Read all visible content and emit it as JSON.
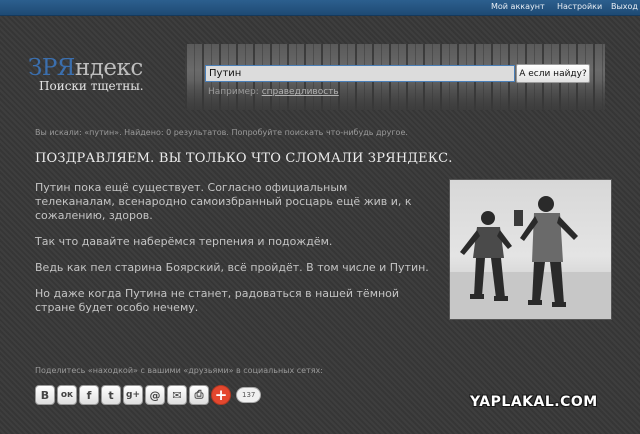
{
  "topnav": {
    "account": "Мой аккаунт",
    "settings": "Настройки",
    "exit": "Выход"
  },
  "logo": {
    "part_blue": "ЗРЯ",
    "part_gray": "ндекс",
    "tagline": "Поиски тщетны."
  },
  "search": {
    "value": "Путин",
    "button": "А если найду?",
    "example_prefix": "Например:",
    "example_link": "справедливость"
  },
  "results": {
    "summary": "Вы искали: «путин». Найдено: 0 результатов. Попробуйте поискать что-нибудь другое."
  },
  "article": {
    "headline": "ПОЗДРАВЛЯЕМ. ВЫ ТОЛЬКО ЧТО СЛОМАЛИ ЗРЯНДЕКС.",
    "paragraphs": [
      "Путин пока ещё существует. Согласно официальным телеканалам, всенародно самоизбранный росцарь ещё жив и, к сожалению, здоров.",
      "Так что давайте наберёмся терпения и подождём.",
      "Ведь как пел старина Боярский, всё пройдёт. В том числе и Путин.",
      "Но даже когда Путина не станет, радоваться в нашей тёмной стране будет особо нечему."
    ]
  },
  "share": {
    "caption": "Поделитесь «находкой» с вашими «друзьями» в социальных сетях:",
    "buttons": [
      {
        "label": "В",
        "name": "vk"
      },
      {
        "label": "ок",
        "name": "odnoklassniki"
      },
      {
        "label": "f",
        "name": "facebook"
      },
      {
        "label": "t",
        "name": "twitter"
      },
      {
        "label": "g+",
        "name": "google-plus"
      },
      {
        "label": "@",
        "name": "email"
      },
      {
        "label": "✉",
        "name": "mail"
      },
      {
        "label": "⎙",
        "name": "print"
      }
    ],
    "plus_label": "+",
    "count": "137"
  },
  "watermark": "YAPLAKAL.COM",
  "colors": {
    "topbar": "#2c5f8e",
    "background": "#3a3a3a",
    "logo_blue": "#3b6fae",
    "share_plus": "#e4472e"
  }
}
